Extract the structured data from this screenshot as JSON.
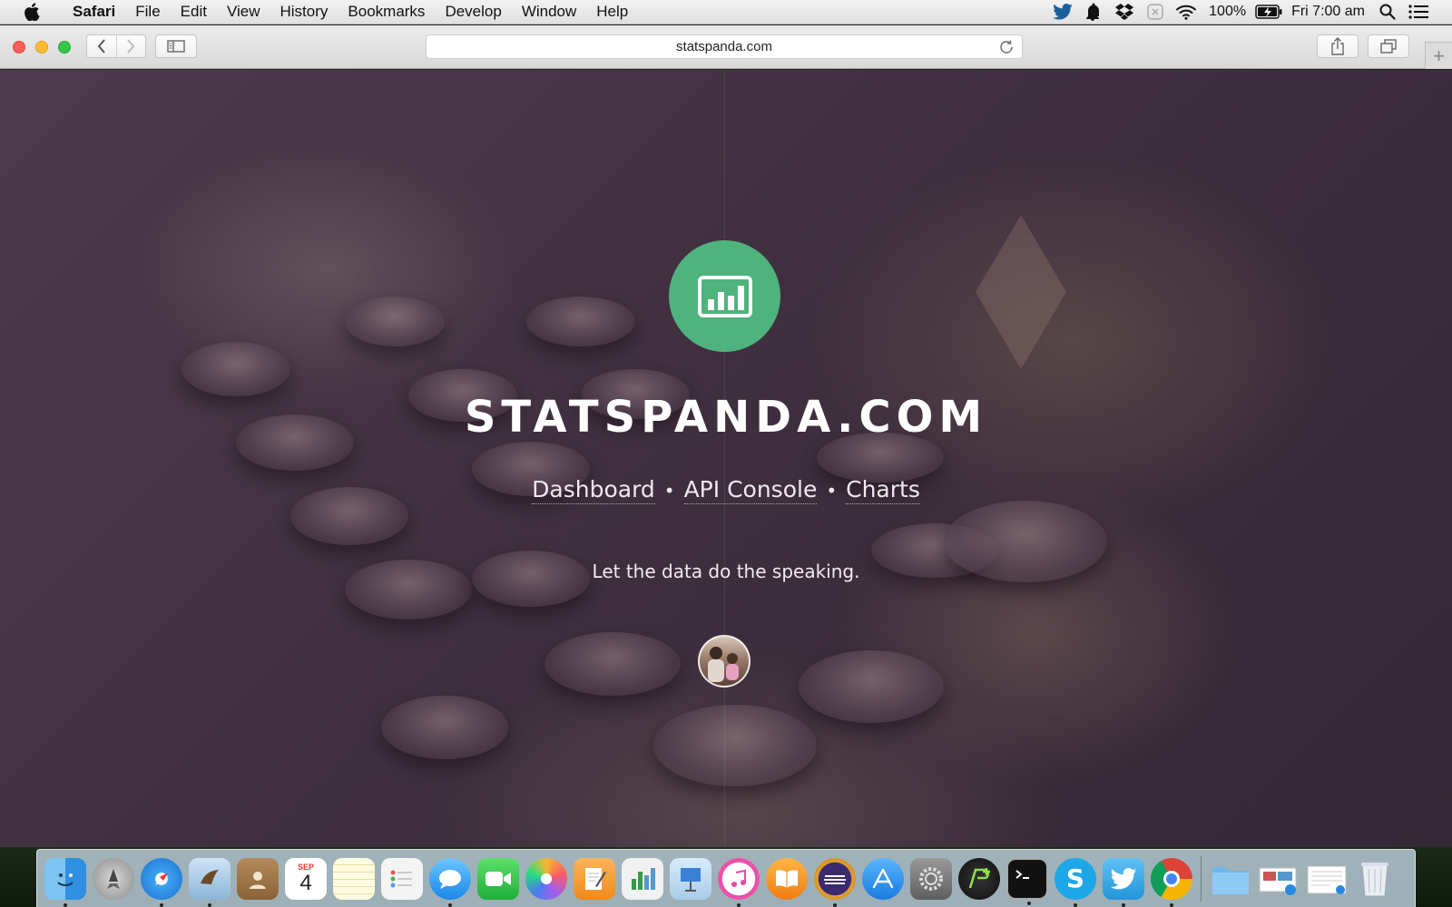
{
  "menubar": {
    "app_name": "Safari",
    "items": [
      "File",
      "Edit",
      "View",
      "History",
      "Bookmarks",
      "Develop",
      "Window",
      "Help"
    ],
    "battery": "100%",
    "clock": "Fri 7:00 am"
  },
  "browser": {
    "url": "statspanda.com"
  },
  "page": {
    "title": "STATSPANDA.COM",
    "nav": [
      "Dashboard",
      "API Console",
      "Charts"
    ],
    "tagline": "Let the data do the speaking.",
    "accent_color": "#4fb37d"
  },
  "dock": {
    "calendar_month": "SEP",
    "calendar_day": "4",
    "apps": [
      "Finder",
      "Launchpad",
      "Safari",
      "Mail",
      "Contacts",
      "Calendar",
      "Notes",
      "Reminders",
      "Messages",
      "FaceTime",
      "Photos",
      "Pages",
      "Numbers",
      "Keynote",
      "iTunes",
      "iBooks",
      "Eclipse",
      "App Store",
      "System Preferences",
      "Plus",
      "Terminal",
      "Skype",
      "Twitter",
      "Chrome",
      "Downloads",
      "Preview",
      "Documents",
      "Trash"
    ]
  }
}
